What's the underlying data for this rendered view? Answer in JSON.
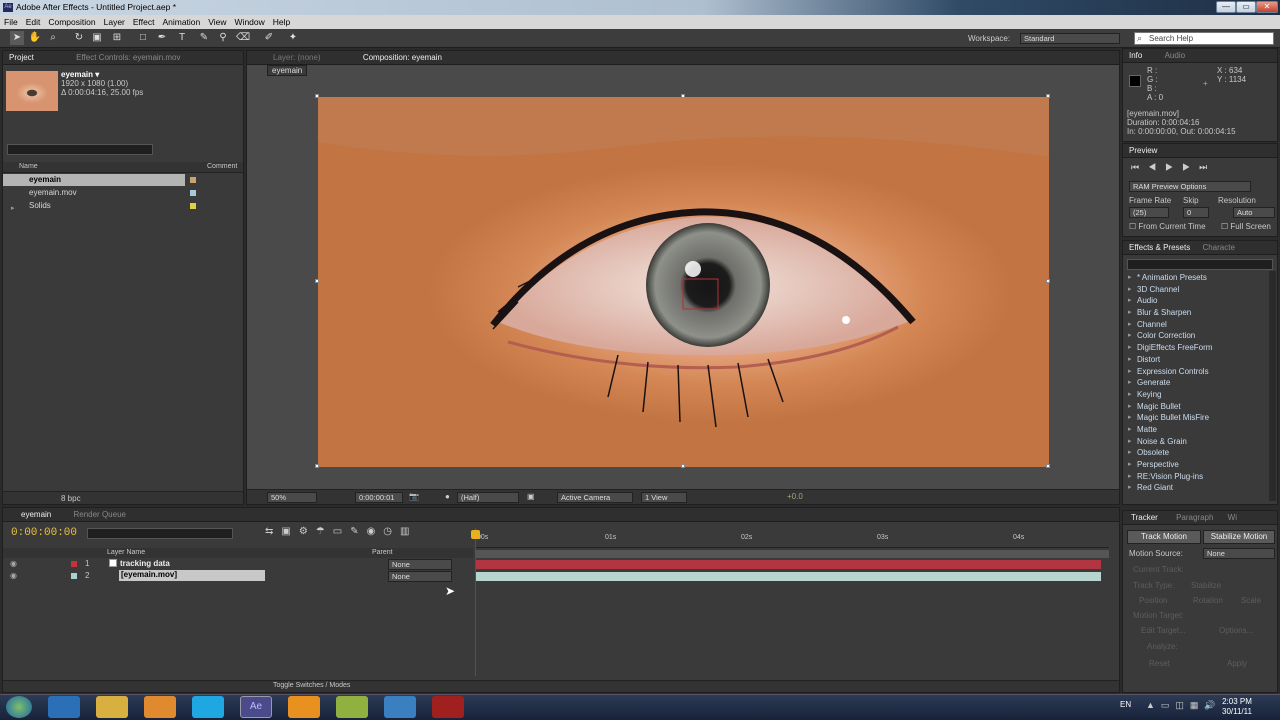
{
  "window": {
    "title": "Adobe After Effects - Untitled Project.aep *",
    "min": "—",
    "max": "▭",
    "close": "✕"
  },
  "menu": [
    "File",
    "Edit",
    "Composition",
    "Layer",
    "Effect",
    "Animation",
    "View",
    "Window",
    "Help"
  ],
  "toolbar": {
    "workspace_label": "Workspace:",
    "workspace_value": "Standard",
    "search_placeholder": "Search Help"
  },
  "project": {
    "tab": "Project",
    "effect_controls": "Effect Controls: eyemain.mov",
    "item_name": "eyemain ▾",
    "item_res": "1920 x 1080 (1.00)",
    "item_dur": "Δ 0:00:04:16, 25.00 fps",
    "col_name": "Name",
    "col_comment": "Comment",
    "items": [
      {
        "name": "eyemain",
        "color": "#c9a36b"
      },
      {
        "name": "eyemain.mov",
        "color": "#a9c9d9"
      },
      {
        "name": "Solids",
        "color": "#e0d040"
      }
    ],
    "bpc": "8 bpc"
  },
  "viewer": {
    "layer_tab": "Layer: (none)",
    "comp_tab": "Composition: eyemain",
    "breadcrumb": "eyemain",
    "zoom": "50%",
    "timecode": "0:00:00:01",
    "quality": "(Half)",
    "camera": "Active Camera",
    "views": "1 View",
    "exposure": "+0.0"
  },
  "info": {
    "tab": "Info",
    "audio_tab": "Audio",
    "r": "R :",
    "g": "G :",
    "b": "B :",
    "a": "A : 0",
    "x": "X : 634",
    "y": "Y : 1134",
    "file": "[eyemain.mov]",
    "duration": "Duration: 0:00:04:16",
    "inout": "In: 0:00:00:00, Out: 0:00:04:15"
  },
  "preview": {
    "tab": "Preview",
    "ram": "RAM Preview Options",
    "frame_rate": "Frame Rate",
    "skip": "Skip",
    "resolution": "Resolution",
    "fr_val": "(25)",
    "skip_val": "0",
    "res_val": "Auto",
    "from_current": "From Current Time",
    "full_screen": "Full Screen"
  },
  "effects": {
    "tab": "Effects & Presets",
    "tab2": "Characte",
    "items": [
      "* Animation Presets",
      "3D Channel",
      "Audio",
      "Blur & Sharpen",
      "Channel",
      "Color Correction",
      "DigiEffects FreeForm",
      "Distort",
      "Expression Controls",
      "Generate",
      "Keying",
      "Magic Bullet",
      "Magic Bullet MisFire",
      "Matte",
      "Noise & Grain",
      "Obsolete",
      "Perspective",
      "RE:Vision Plug-ins",
      "Red Giant"
    ]
  },
  "timeline": {
    "tab": "eyemain",
    "render_tab": "Render Queue",
    "timecode": "0:00:00:00",
    "col_layer": "Layer Name",
    "col_parent": "Parent",
    "layers": [
      {
        "num": "1",
        "name": "tracking data",
        "parent": "None",
        "color": "#c83040"
      },
      {
        "num": "2",
        "name": "[eyemain.mov]",
        "parent": "None",
        "color": "#a9d0d0"
      }
    ],
    "ticks": [
      "00s",
      "01s",
      "02s",
      "03s",
      "04s"
    ],
    "toggle": "Toggle Switches / Modes"
  },
  "tracker": {
    "tab": "Tracker",
    "tab2": "Paragraph",
    "tab3": "Wi",
    "track_motion": "Track Motion",
    "stabilize": "Stabilize Motion",
    "motion_source": "Motion Source:",
    "source_val": "None",
    "current_track": "Current Track:",
    "track_type": "Track Type:",
    "track_type_val": "Stabilize",
    "position": "Position",
    "rotation": "Rotation",
    "scale": "Scale",
    "motion_target": "Motion Target:",
    "edit_target": "Edit Target...",
    "options": "Options...",
    "analyze": "Analyze:",
    "reset": "Reset",
    "apply": "Apply"
  },
  "taskbar": {
    "lang": "EN",
    "time": "2:03 PM",
    "date": "30/11/11"
  }
}
